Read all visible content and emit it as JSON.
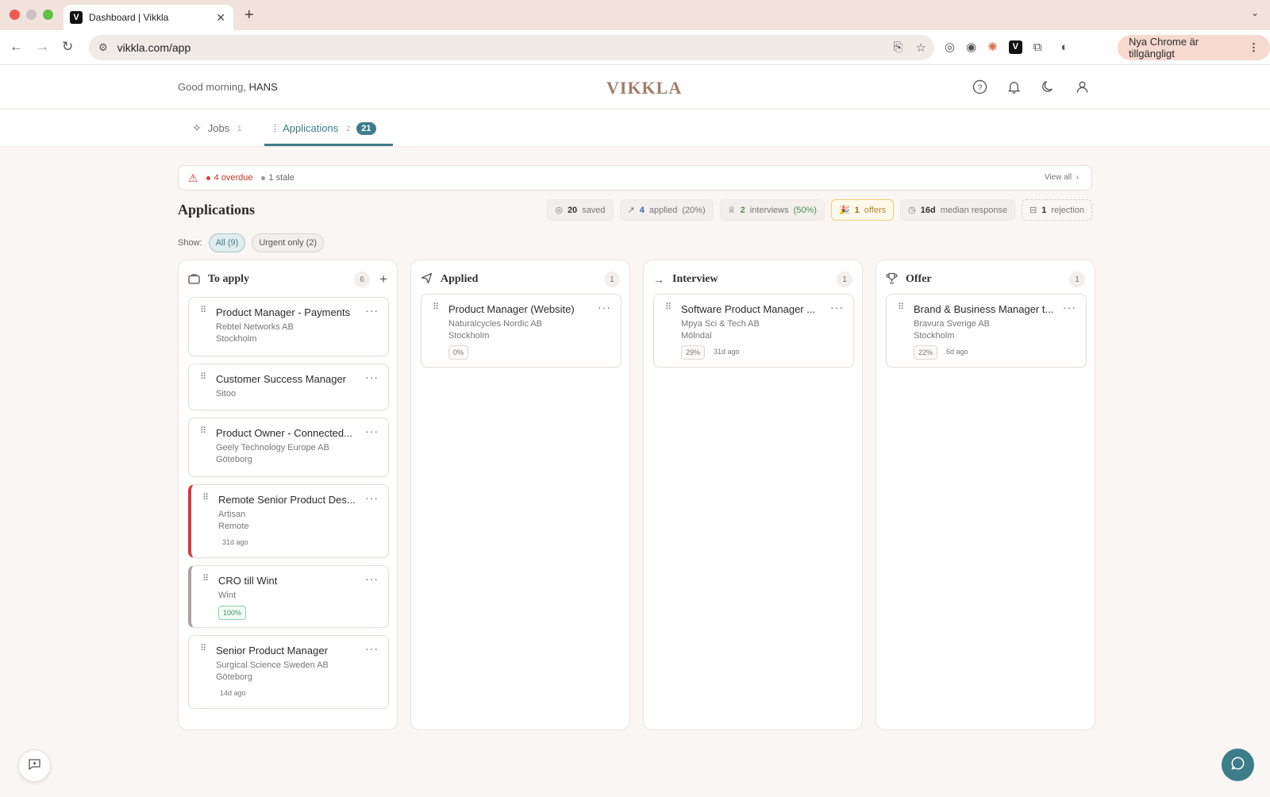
{
  "browser": {
    "tab_title": "Dashboard | Vikkla",
    "tab_favicon": "V",
    "url": "vikkla.com/app",
    "update_label": "Nya Chrome är tillgängligt"
  },
  "header": {
    "greeting_prefix": "Good morning,",
    "user_name": "HANS",
    "logo": "VIKKLA"
  },
  "nav": {
    "jobs_label": "Jobs",
    "jobs_num": "1",
    "applications_label": "Applications",
    "applications_num": "2",
    "applications_badge": "21"
  },
  "alerts": {
    "overdue": "4 overdue",
    "stale": "1 stale",
    "view_all": "View all"
  },
  "section": {
    "title": "Applications",
    "stats": {
      "saved_num": "20",
      "saved_label": "saved",
      "applied_num": "4",
      "applied_label": "applied",
      "applied_pct": "(20%)",
      "interviews_num": "2",
      "interviews_label": "interviews",
      "interviews_pct": "(50%)",
      "offers_num": "1",
      "offers_label": "offers",
      "median_num": "16d",
      "median_label": "median response",
      "rejection_num": "1",
      "rejection_label": "rejection"
    },
    "show_label": "Show:",
    "filter_all": "All (9)",
    "filter_urgent": "Urgent only (2)"
  },
  "columns": {
    "to_apply": {
      "title": "To apply",
      "count": "6",
      "cards": [
        {
          "title": "Product Manager - Payments",
          "company": "Rebtel Networks AB",
          "location": "Stockholm"
        },
        {
          "title": "Customer Success Manager",
          "company": "Sitoo"
        },
        {
          "title": "Product Owner - Connected...",
          "company": "Geely Technology Europe AB",
          "location": "Göteborg"
        },
        {
          "title": "Remote Senior Product Des...",
          "company": "Artisan",
          "location": "Remote",
          "age": "31d ago"
        },
        {
          "title": "CRO till Wint",
          "company": "Wint",
          "match": "100%"
        },
        {
          "title": "Senior Product Manager",
          "company": "Surgical Science Sweden AB",
          "location": "Göteborg",
          "age": "14d ago"
        }
      ]
    },
    "applied": {
      "title": "Applied",
      "count": "1",
      "cards": [
        {
          "title": "Product Manager (Website)",
          "company": "Naturalcycles Nordic AB",
          "location": "Stockholm",
          "match": "0%"
        }
      ]
    },
    "interview": {
      "title": "Interview",
      "count": "1",
      "cards": [
        {
          "title": "Software Product Manager ...",
          "company": "Mpya Sci & Tech AB",
          "location": "Mölndal",
          "match": "29%",
          "age": "31d ago"
        }
      ]
    },
    "offer": {
      "title": "Offer",
      "count": "1",
      "cards": [
        {
          "title": "Brand & Business Manager t...",
          "company": "Bravura Sverige AB",
          "location": "Stockholm",
          "match": "22%",
          "age": "6d ago"
        }
      ]
    }
  },
  "colors": {
    "accent": "#3d7d8a",
    "urgent": "#d23b3b",
    "offer_highlight": "#f0cf7a"
  },
  "icons": [
    "alert-triangle-icon",
    "help-icon",
    "bell-icon",
    "moon-icon",
    "user-icon",
    "sparkles-icon",
    "kanban-icon",
    "briefcase-icon",
    "send-icon",
    "arrow-right-icon",
    "trophy-icon",
    "feedback-icon",
    "chat-icon"
  ]
}
